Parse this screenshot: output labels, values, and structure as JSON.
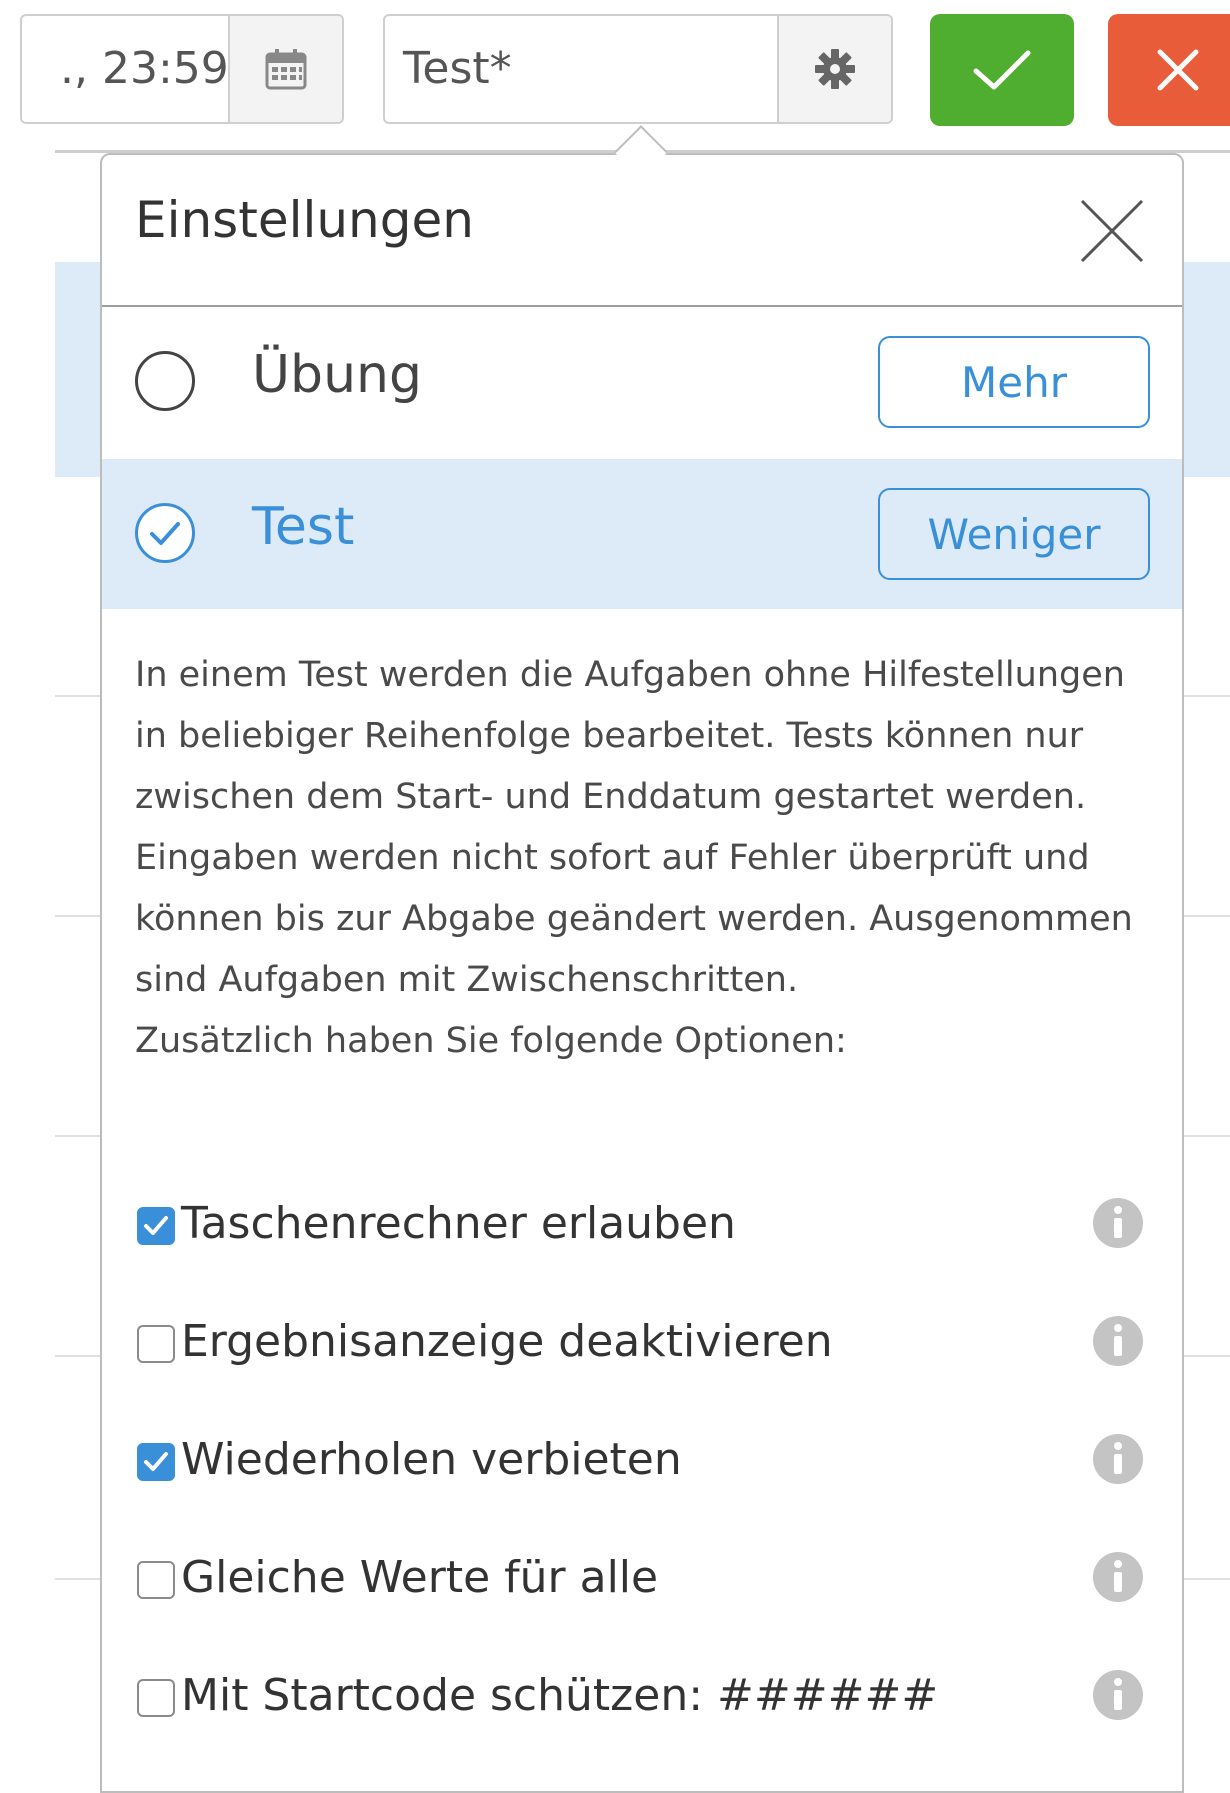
{
  "toolbar": {
    "end_time_value": "., 23:59",
    "mode_value": "Test*",
    "calendar_icon": "calendar-icon",
    "settings_icon": "gear-icon",
    "confirm_icon": "checkmark-icon",
    "cancel_icon": "close-icon",
    "confirm_color": "#4fae2f",
    "cancel_color": "#e95c3a"
  },
  "settings": {
    "title": "Einstellungen",
    "modes": [
      {
        "label": "Übung",
        "button": "Mehr",
        "selected": false
      },
      {
        "label": "Test",
        "button": "Weniger",
        "selected": true
      }
    ],
    "description": [
      "In einem Test werden die Aufgaben ohne Hilfestellungen in beliebiger Reihenfolge bearbeitet. Tests können nur zwischen dem Start- und Enddatum gestartet werden. Eingaben werden nicht sofort auf Fehler überprüft und können bis zur Abgabe geändert werden. Ausgenommen sind Aufgaben mit Zwischenschritten.",
      "Zusätzlich haben Sie folgende Optionen:"
    ],
    "options": [
      {
        "label": "Taschenrechner erlauben",
        "checked": true
      },
      {
        "label": "Ergebnisanzeige deaktivieren",
        "checked": false
      },
      {
        "label": "Wiederholen verbieten",
        "checked": true
      },
      {
        "label": "Gleiche Werte für alle",
        "checked": false
      },
      {
        "label": "Mit Startcode schützen: ######",
        "checked": false
      }
    ],
    "accent_color": "#3a8fd9",
    "selected_row_color": "#dcebf7"
  }
}
